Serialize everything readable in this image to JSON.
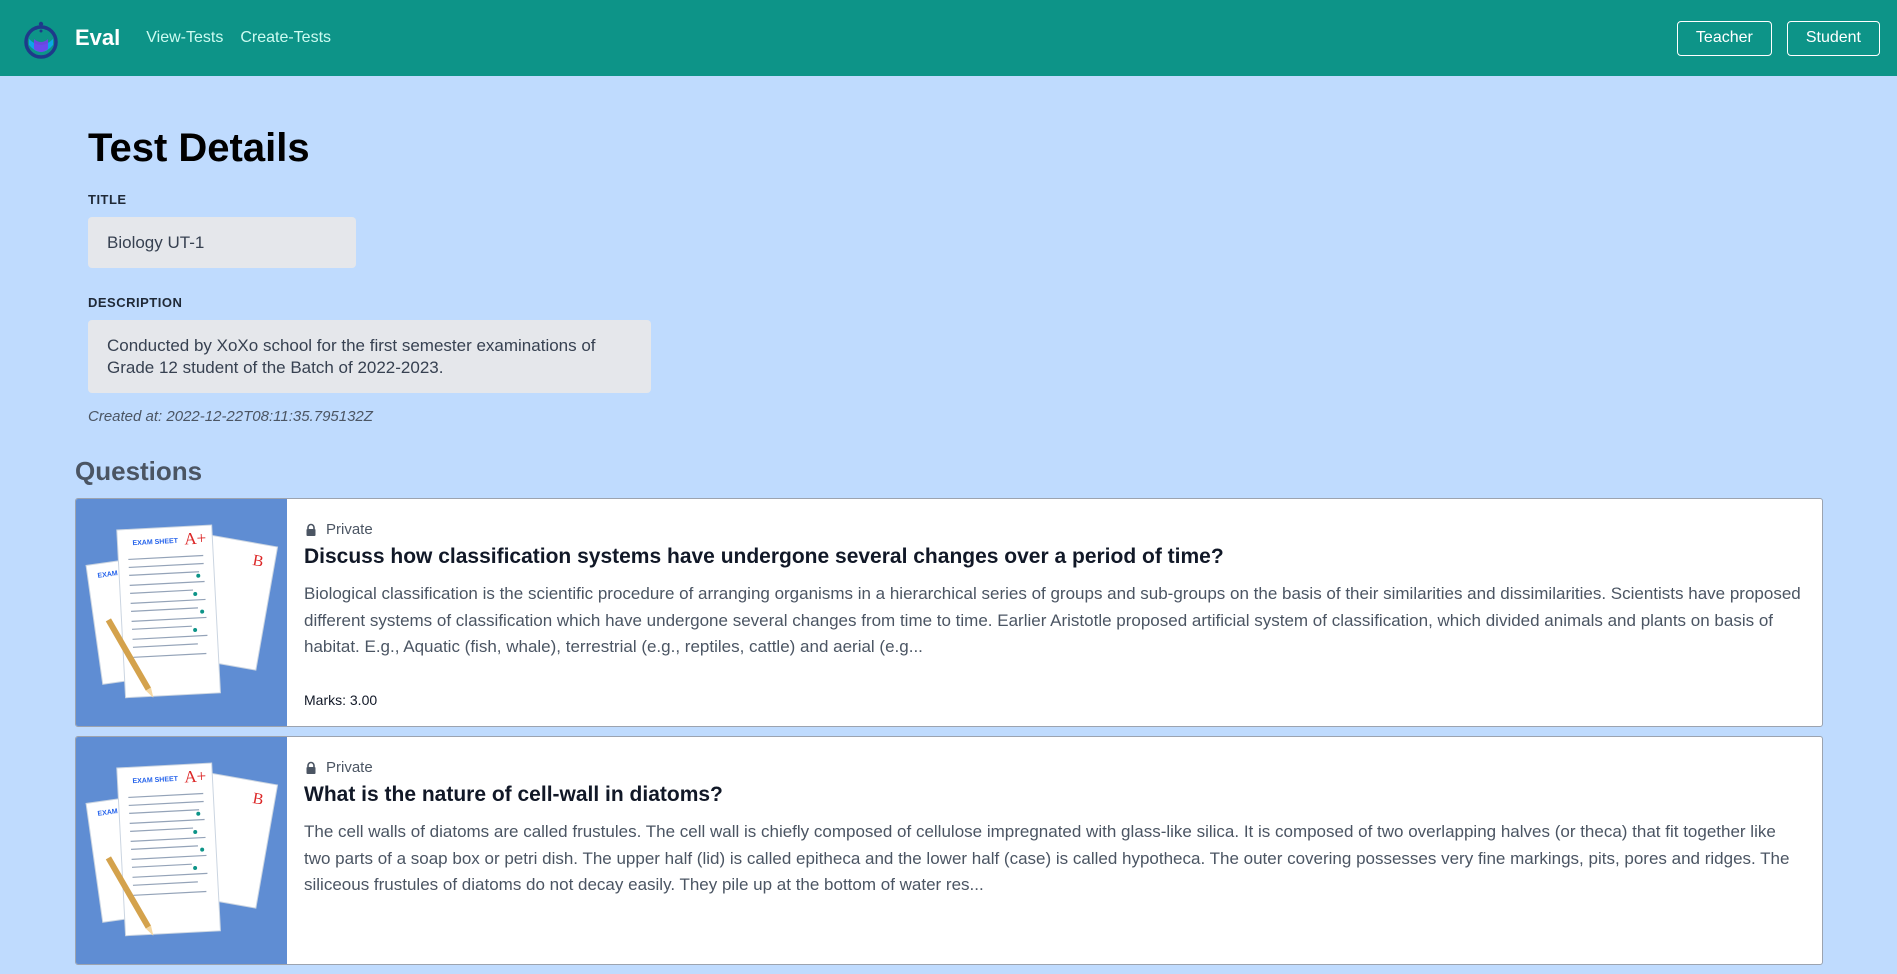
{
  "navbar": {
    "brand": "Eval",
    "links": [
      "View-Tests",
      "Create-Tests"
    ],
    "buttons": [
      "Teacher",
      "Student"
    ],
    "color": "#0d9488"
  },
  "details": {
    "heading": "Test Details",
    "title_label": "TITLE",
    "title_value": "Biology UT-1",
    "description_label": "DESCRIPTION",
    "description_value": "Conducted by XoXo school for the first semester examinations of Grade 12 student of the Batch of 2022-2023.",
    "created_label": "Created at:",
    "created_value": "2022-12-22T08:11:35.795132Z"
  },
  "questions_heading": "Questions",
  "questions": [
    {
      "visibility": "Private",
      "title": "Discuss how classification systems have undergone several changes over a period of time?",
      "text": "Biological classification is the scientific procedure of arranging organisms in a hierarchical series of groups and sub-groups on the basis of their similarities and dissimilarities. Scientists have proposed different systems of classification which have undergone several changes from time to time. Earlier Aristotle proposed artificial system of classification, which divided animals and plants on basis of habitat. E.g., Aquatic (fish, whale), terrestrial (e.g., reptiles, cattle) and aerial (e.g...",
      "marks": "Marks: 3.00",
      "thumbnail_icon": "exam-sheet-image"
    },
    {
      "visibility": "Private",
      "title": "What is the nature of cell-wall in diatoms?",
      "text": "The cell walls of diatoms are called frustules. The cell wall is chiefly composed of cellulose impregnated with glass-like silica. It is composed of two overlapping halves (or theca) that fit together like two parts of a soap box or petri dish. The upper half (lid) is called epitheca and the lower half (case) is called hypotheca. The outer covering possesses very fine markings, pits, pores and ridges. The siliceous frustules of diatoms do not decay easily. They pile up at the bottom of water res...",
      "marks": "",
      "thumbnail_icon": "exam-sheet-image"
    }
  ],
  "thumbnail_text": {
    "sheet_heading": "EXAM SHEET",
    "grade_a": "A+",
    "grade_b": "B"
  },
  "colors": {
    "page_background": "#bfdbfe",
    "thumbnail_background": "#5f8dd3"
  }
}
